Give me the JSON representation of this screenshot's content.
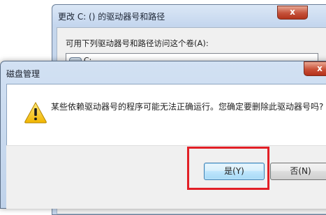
{
  "background_window": {
    "title": "更改 C: () 的驱动器号和路径",
    "close_label": "x",
    "prompt": "可用下列驱动器号和路径访问这个卷(A):",
    "list_items": [
      {
        "label": "C:",
        "icon": "drive-icon"
      }
    ]
  },
  "dialog": {
    "title": "磁盘管理",
    "close_label": "x",
    "icon": "warning-icon",
    "message": "某些依赖驱动器号的程序可能无法正确运行。您确定要删除此驱动器号吗?",
    "buttons": {
      "yes_label": "是(Y)",
      "no_label": "否(N)"
    }
  },
  "annotation": {
    "highlight_color": "#e21f26",
    "highlighted_element": "yes-button"
  }
}
